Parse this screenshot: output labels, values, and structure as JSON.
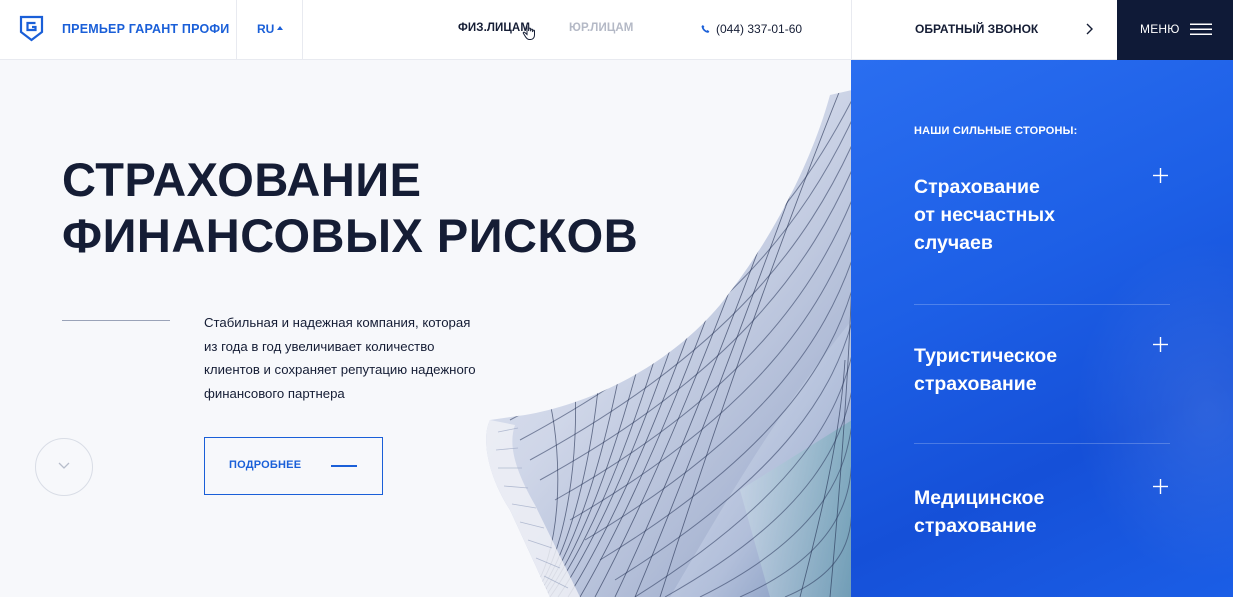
{
  "header": {
    "brand": "ПРЕМЬЕР ГАРАНТ ПРОФИ",
    "lang": "RU",
    "nav": [
      {
        "label": "ФИЗ.ЛИЦАМ",
        "active": true
      },
      {
        "label": "ЮР.ЛИЦАМ",
        "active": false
      }
    ],
    "phone": "(044) 337-01-60",
    "callback": "ОБРАТНЫЙ ЗВОНОК",
    "menu": "МЕНЮ"
  },
  "hero": {
    "title_lines": [
      "СТРАХОВАНИЕ",
      "ФИНАНСОВЫХ РИСКОВ"
    ],
    "description_lines": [
      "Стабильная и надежная компания, которая",
      "из года в год увеличивает количество",
      "клиентов и сохраняет репутацию надежного",
      "финансового партнера"
    ],
    "more_button": "ПОДРОБНЕЕ"
  },
  "panel": {
    "caption": "НАШИ СИЛЬНЫЕ СТОРОНЫ:",
    "features": [
      {
        "lines": [
          "Страхование",
          "от несчастных",
          "случаев"
        ]
      },
      {
        "lines": [
          "Туристическое",
          "страхование"
        ]
      },
      {
        "lines": [
          "Медицинское",
          "страхование"
        ]
      }
    ]
  },
  "colors": {
    "brand_blue": "#1a5fd8",
    "dark_navy": "#0f1a37",
    "text_dark": "#151d35",
    "inactive_gray": "#b4b9c6"
  },
  "icons": [
    "logo-icon",
    "caret-up-icon",
    "cursor-hand-icon",
    "phone-icon",
    "chevron-right-icon",
    "hamburger-icon",
    "chevron-down-icon",
    "plus-icon"
  ]
}
